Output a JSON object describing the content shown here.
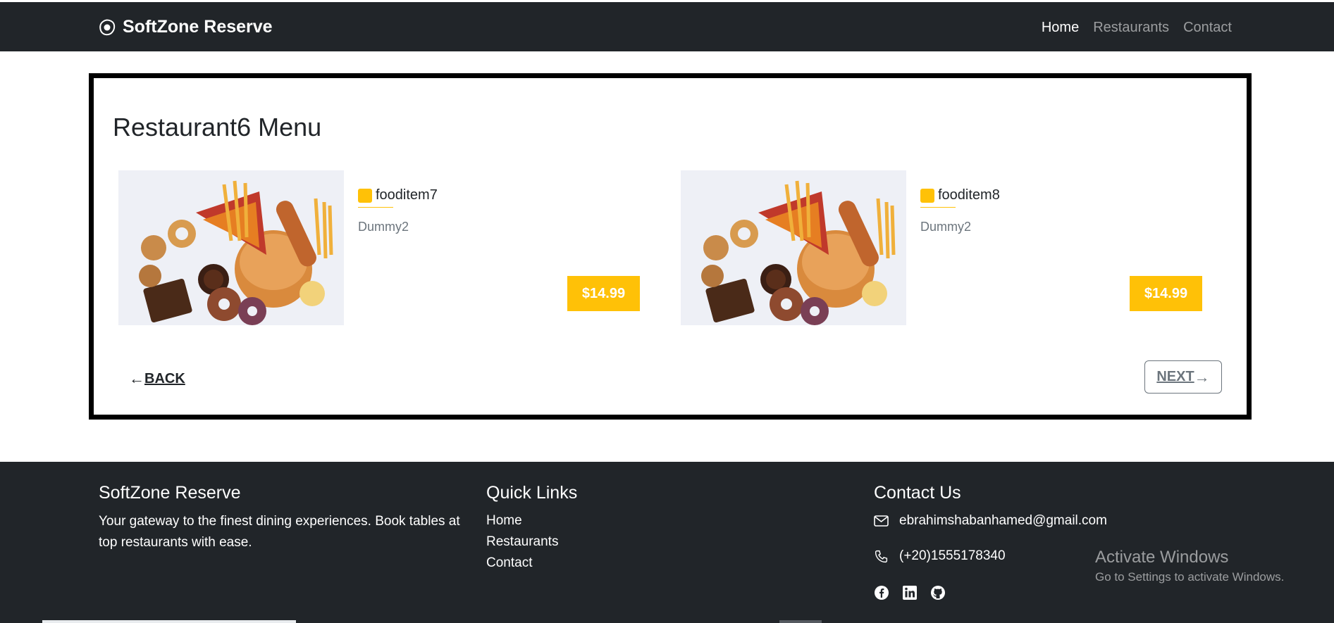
{
  "navbar": {
    "brand": "SoftZone Reserve",
    "links": [
      {
        "label": "Home",
        "active": true
      },
      {
        "label": "Restaurants",
        "active": false
      },
      {
        "label": "Contact",
        "active": false
      }
    ]
  },
  "menu": {
    "title": "Restaurant6 Menu",
    "items": [
      {
        "name": "fooditem7",
        "description": "Dummy2",
        "price": "$14.99"
      },
      {
        "name": "fooditem8",
        "description": "Dummy2",
        "price": "$14.99"
      }
    ],
    "back_label": "BACK",
    "next_label": "NEXT"
  },
  "footer": {
    "about": {
      "title": "SoftZone Reserve",
      "text": "Your gateway to the finest dining experiences. Book tables at top restaurants with ease."
    },
    "quick_links": {
      "title": "Quick Links",
      "links": [
        "Home",
        "Restaurants",
        "Contact"
      ]
    },
    "contact": {
      "title": "Contact Us",
      "email": "ebrahimshabanhamed@gmail.com",
      "phone": "(+20)1555178340",
      "socials": [
        "facebook-icon",
        "linkedin-icon",
        "github-icon"
      ]
    }
  },
  "windows_watermark": {
    "line1": "Activate Windows",
    "line2": "Go to Settings to activate Windows."
  },
  "colors": {
    "dark": "#212529",
    "accent": "#ffc107",
    "muted": "#6c757d"
  }
}
